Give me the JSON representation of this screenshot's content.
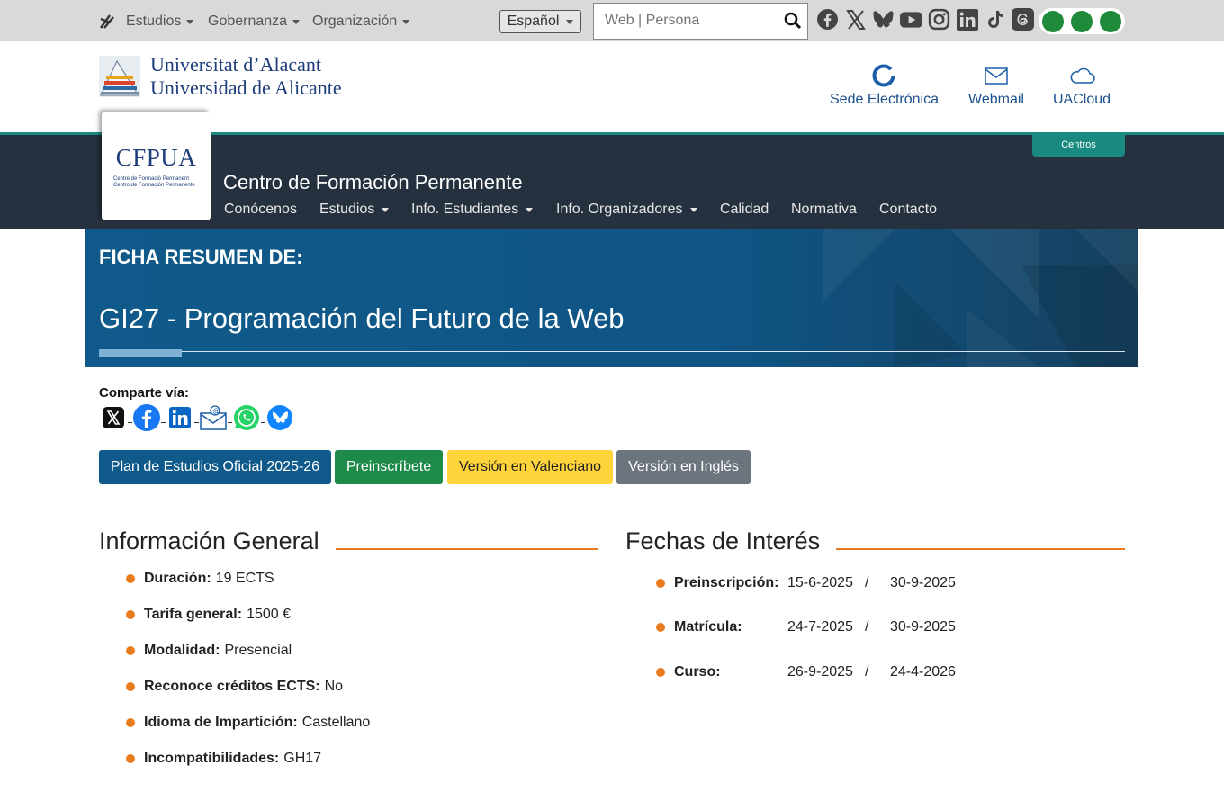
{
  "topbar": {
    "menus": [
      "Estudios",
      "Gobernanza",
      "Organización"
    ],
    "language": "Español",
    "search_placeholder": "Web | Persona",
    "socials": [
      "facebook-icon",
      "x-icon",
      "bluesky-icon",
      "youtube-icon",
      "instagram-icon",
      "linkedin-icon",
      "tiktok-icon",
      "threads-icon"
    ],
    "accent_green": "#1e8a3a"
  },
  "header": {
    "university_line1": "Universitat d’Alacant",
    "university_line2": "Universidad de Alicante",
    "links": [
      "Sede Electrónica",
      "Webmail",
      "UACloud"
    ]
  },
  "center": {
    "logo_text": "CFPUA",
    "logo_sub1": "Centre de Formació Permanent",
    "logo_sub2": "Centro de Formación Permanente",
    "title": "Centro de Formación Permanente",
    "centros_label": "Centros",
    "nav": [
      "Conócenos",
      "Estudios",
      "Info. Estudiantes",
      "Info. Organizadores",
      "Calidad",
      "Normativa",
      "Contacto"
    ]
  },
  "hero": {
    "kicker": "FICHA RESUMEN DE:",
    "title": "GI27 - Programación del Futuro de la Web"
  },
  "share": {
    "label": "Comparte vía:",
    "icons": [
      "x-share-icon",
      "facebook-share-icon",
      "linkedin-share-icon",
      "email-share-icon",
      "whatsapp-share-icon",
      "bluesky-share-icon"
    ]
  },
  "actions": {
    "plan": "Plan de Estudios Oficial 2025-26",
    "preinscribete": "Preinscríbete",
    "valenciano": "Versión en Valenciano",
    "ingles": "Versión en Inglés"
  },
  "info_general": {
    "title": "Información General",
    "items": [
      {
        "label": "Duración:",
        "value": "19 ECTS"
      },
      {
        "label": "Tarifa general:",
        "value": "1500 €"
      },
      {
        "label": "Modalidad:",
        "value": "Presencial"
      },
      {
        "label": "Reconoce créditos ECTS:",
        "value": "No"
      },
      {
        "label": "Idioma de Impartición:",
        "value": "Castellano"
      },
      {
        "label": "Incompatibilidades:",
        "value": "GH17"
      }
    ]
  },
  "fechas": {
    "title": "Fechas de Interés",
    "items": [
      {
        "label": "Preinscripción:",
        "start": "15-6-2025",
        "sep": "/",
        "end": "30-9-2025"
      },
      {
        "label": "Matrícula:",
        "start": "24-7-2025",
        "sep": "/",
        "end": "30-9-2025"
      },
      {
        "label": "Curso:",
        "start": "26-9-2025",
        "sep": "/",
        "end": "24-4-2026"
      }
    ]
  },
  "colors": {
    "primary_blue": "#0f5a8a",
    "nav_dark": "#263140",
    "teal": "#1a8a80",
    "orange": "#e87b1e"
  }
}
